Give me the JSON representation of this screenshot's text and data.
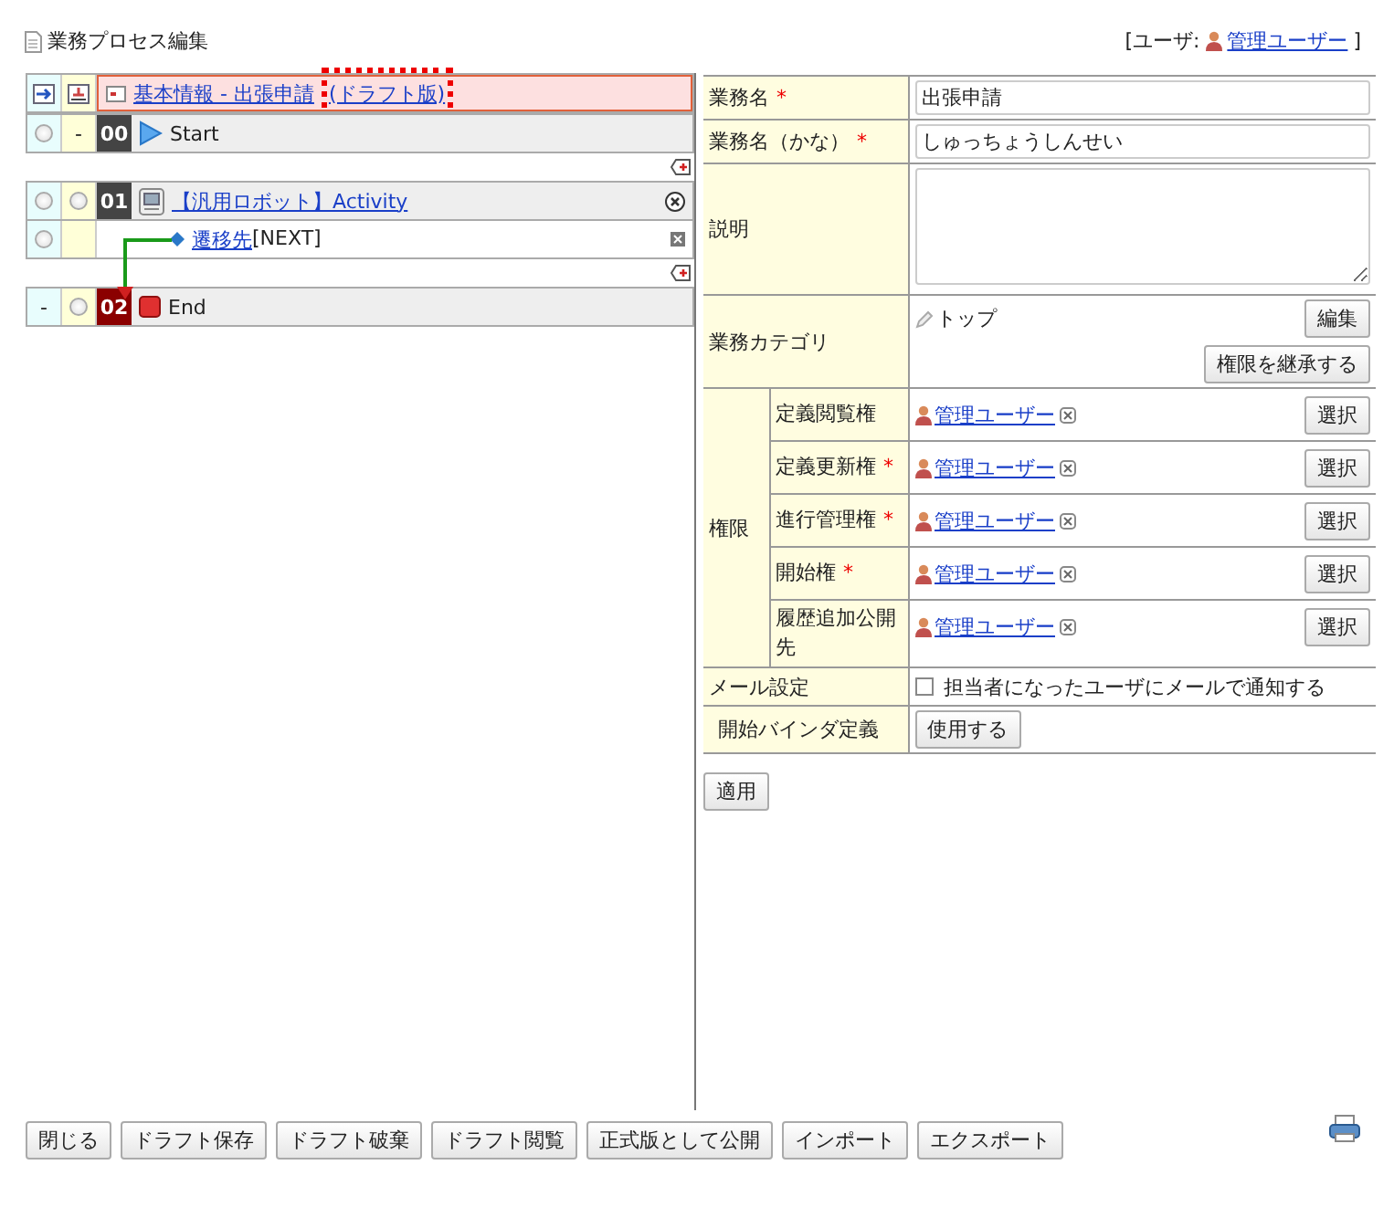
{
  "page_title": "業務プロセス編集",
  "user": {
    "label": "[ユーザ:",
    "name": "管理ユーザー",
    "end": "]"
  },
  "process_map": {
    "title": "基本情報 - 出張申請",
    "draft_label": "(ドラフト版)",
    "draft_highlighted": true,
    "nodes": [
      {
        "kind": "start",
        "cells": [
          {
            "kind": "radio",
            "selected": false
          },
          {
            "kind": "text",
            "text": "-"
          }
        ],
        "number": "00",
        "label": "Start"
      },
      {
        "kind": "activity",
        "cells": [
          {
            "kind": "radio",
            "selected": false
          },
          {
            "kind": "radio",
            "selected": false
          }
        ],
        "number": "01",
        "label": "【汎用ロボット】Activity",
        "transitions": [
          {
            "cells": [
              {
                "kind": "radio",
                "selected": false
              },
              {
                "kind": "empty"
              }
            ],
            "label": "遷移先",
            "target": "[NEXT]"
          }
        ]
      },
      {
        "kind": "end",
        "cells": [
          {
            "kind": "text",
            "text": "-"
          },
          {
            "kind": "radio",
            "selected": false
          }
        ],
        "number": "02",
        "label": "End"
      }
    ]
  },
  "form": {
    "rows": [
      {
        "kind": "text",
        "label": "業務名",
        "mark": "*",
        "value": "出張申請"
      },
      {
        "kind": "text",
        "label": "業務名（かな）",
        "mark": "*",
        "value": "しゅっちょうしんせい"
      },
      {
        "kind": "textarea",
        "label": "説明"
      },
      {
        "kind": "category",
        "label": "業務カテゴリ",
        "value": "トップ",
        "buttons": [
          "編集",
          "権限を継承する"
        ]
      },
      {
        "kind": "permissions",
        "label": "権限",
        "items": [
          {
            "label": "定義閲覧権",
            "user": "管理ユーザー",
            "button": "選択"
          },
          {
            "label": "定義更新権",
            "mark": "*",
            "user": "管理ユーザー",
            "button": "選択"
          },
          {
            "label": "進行管理権",
            "mark": "*",
            "user": "管理ユーザー",
            "button": "選択"
          },
          {
            "label": "開始権",
            "mark": "*",
            "user": "管理ユーザー",
            "button": "選択"
          },
          {
            "label": "履歴追加公開先",
            "user": "管理ユーザー",
            "button": "選択"
          }
        ]
      },
      {
        "kind": "checkbox",
        "label": "メール設定",
        "checked": false,
        "text": "担当者になったユーザにメールで通知する"
      },
      {
        "kind": "button",
        "label": "開始バインダ定義",
        "button": "使用する"
      }
    ]
  },
  "apply_button": "適用",
  "footer_buttons": [
    "閉じる",
    "ドラフト保存",
    "ドラフト破棄",
    "ドラフト閲覧",
    "正式版として公開",
    "インポート",
    "エクスポート"
  ]
}
